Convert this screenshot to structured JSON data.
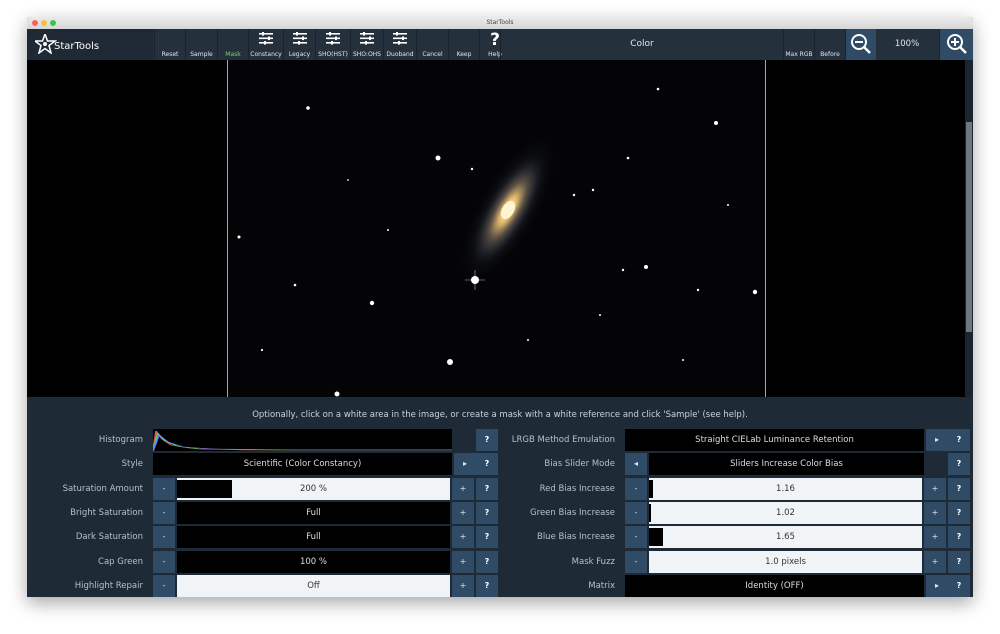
{
  "window": {
    "title": "StarTools"
  },
  "app": {
    "logo_text": "StarTools",
    "module_title": "Color"
  },
  "toolbar": {
    "buttons": [
      {
        "label": "Reset",
        "icon": ""
      },
      {
        "label": "Sample",
        "icon": ""
      },
      {
        "label": "Mask",
        "icon": "",
        "color": "#7dd07a"
      },
      {
        "label": "Constancy",
        "icon": "sliders-icon"
      },
      {
        "label": "Legacy",
        "icon": "sliders-icon"
      },
      {
        "label": "SHO(HST)",
        "icon": "sliders-icon"
      },
      {
        "label": "SHO:OHS",
        "icon": "sliders-icon"
      },
      {
        "label": "Duoband",
        "icon": "sliders-icon"
      },
      {
        "label": "Cancel",
        "icon": ""
      },
      {
        "label": "Keep",
        "icon": ""
      },
      {
        "label": "Help",
        "icon": "question-icon"
      }
    ],
    "right_buttons": [
      {
        "label": "Max RGB"
      },
      {
        "label": "Before"
      }
    ],
    "zoom_level": "100%"
  },
  "hint_text": "Optionally, click on a white area in the image, or create a mask with a white reference and click 'Sample' (see help).",
  "left_params": [
    {
      "label": "Histogram",
      "type": "histogram"
    },
    {
      "label": "Style",
      "type": "select",
      "value": "Scientific (Color Constancy)"
    },
    {
      "label": "Saturation Amount",
      "type": "slider",
      "value": "200 %",
      "fill": 0.2
    },
    {
      "label": "Bright Saturation",
      "type": "slider",
      "value": "Full",
      "fill": 1.0
    },
    {
      "label": "Dark Saturation",
      "type": "slider",
      "value": "Full",
      "fill": 1.0
    },
    {
      "label": "Cap Green",
      "type": "slider",
      "value": "100 %",
      "fill": 1.0
    },
    {
      "label": "Highlight Repair",
      "type": "slider",
      "value": "Off",
      "fill": 0
    }
  ],
  "right_params": [
    {
      "label": "LRGB Method Emulation",
      "type": "select",
      "value": "Straight CIELab Luminance Retention"
    },
    {
      "label": "Bias Slider Mode",
      "type": "select2",
      "value": "Sliders Increase Color Bias"
    },
    {
      "label": "Red Bias Increase",
      "type": "slider",
      "value": "1.16",
      "fill": 0.016
    },
    {
      "label": "Green Bias Increase",
      "type": "slider",
      "value": "1.02",
      "fill": 0.003
    },
    {
      "label": "Blue Bias Increase",
      "type": "slider",
      "value": "1.65",
      "fill": 0.05
    },
    {
      "label": "Mask Fuzz",
      "type": "slider",
      "value": "1.0 pixels",
      "fill": 0.0
    },
    {
      "label": "Matrix",
      "type": "select",
      "value": "Identity (OFF)"
    }
  ],
  "controls": {
    "minus": "-",
    "plus": "+",
    "help": "?",
    "arrow_right": "▸",
    "arrow_left": "◂"
  }
}
